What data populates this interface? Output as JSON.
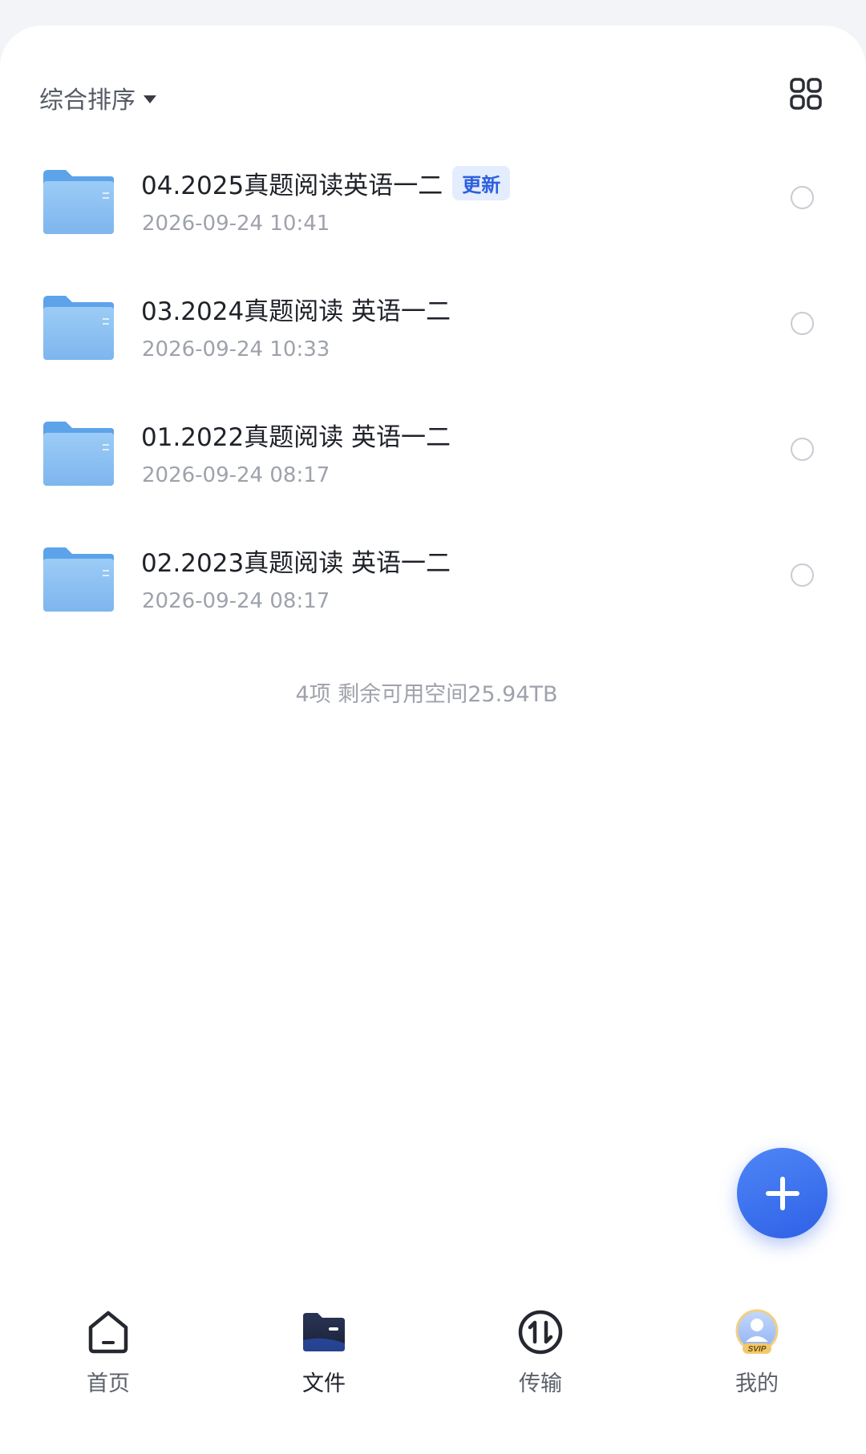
{
  "toolbar": {
    "sort_label": "综合排序",
    "view_toggle_icon": "grid-view-icon"
  },
  "files": [
    {
      "name": "04.2025真题阅读英语一二",
      "date": "2026-09-24 10:41",
      "badge": "更新",
      "icon": "folder-icon"
    },
    {
      "name": "03.2024真题阅读 英语一二",
      "date": "2026-09-24 10:33",
      "badge": "",
      "icon": "folder-icon"
    },
    {
      "name": "01.2022真题阅读 英语一二",
      "date": "2026-09-24 08:17",
      "badge": "",
      "icon": "folder-icon"
    },
    {
      "name": "02.2023真题阅读 英语一二",
      "date": "2026-09-24 08:17",
      "badge": "",
      "icon": "folder-icon"
    }
  ],
  "summary": "4项 剩余可用空间25.94TB",
  "fab": {
    "icon": "plus-icon"
  },
  "nav": [
    {
      "label": "首页",
      "icon": "home-icon"
    },
    {
      "label": "文件",
      "icon": "folder-icon"
    },
    {
      "label": "传输",
      "icon": "transfer-icon"
    },
    {
      "label": "我的",
      "icon": "avatar-svip-icon",
      "badge": "SVIP"
    }
  ],
  "colors": {
    "accent": "#2e61e6",
    "badge_bg": "#e4edfd",
    "folder": "#8fc2f4"
  }
}
